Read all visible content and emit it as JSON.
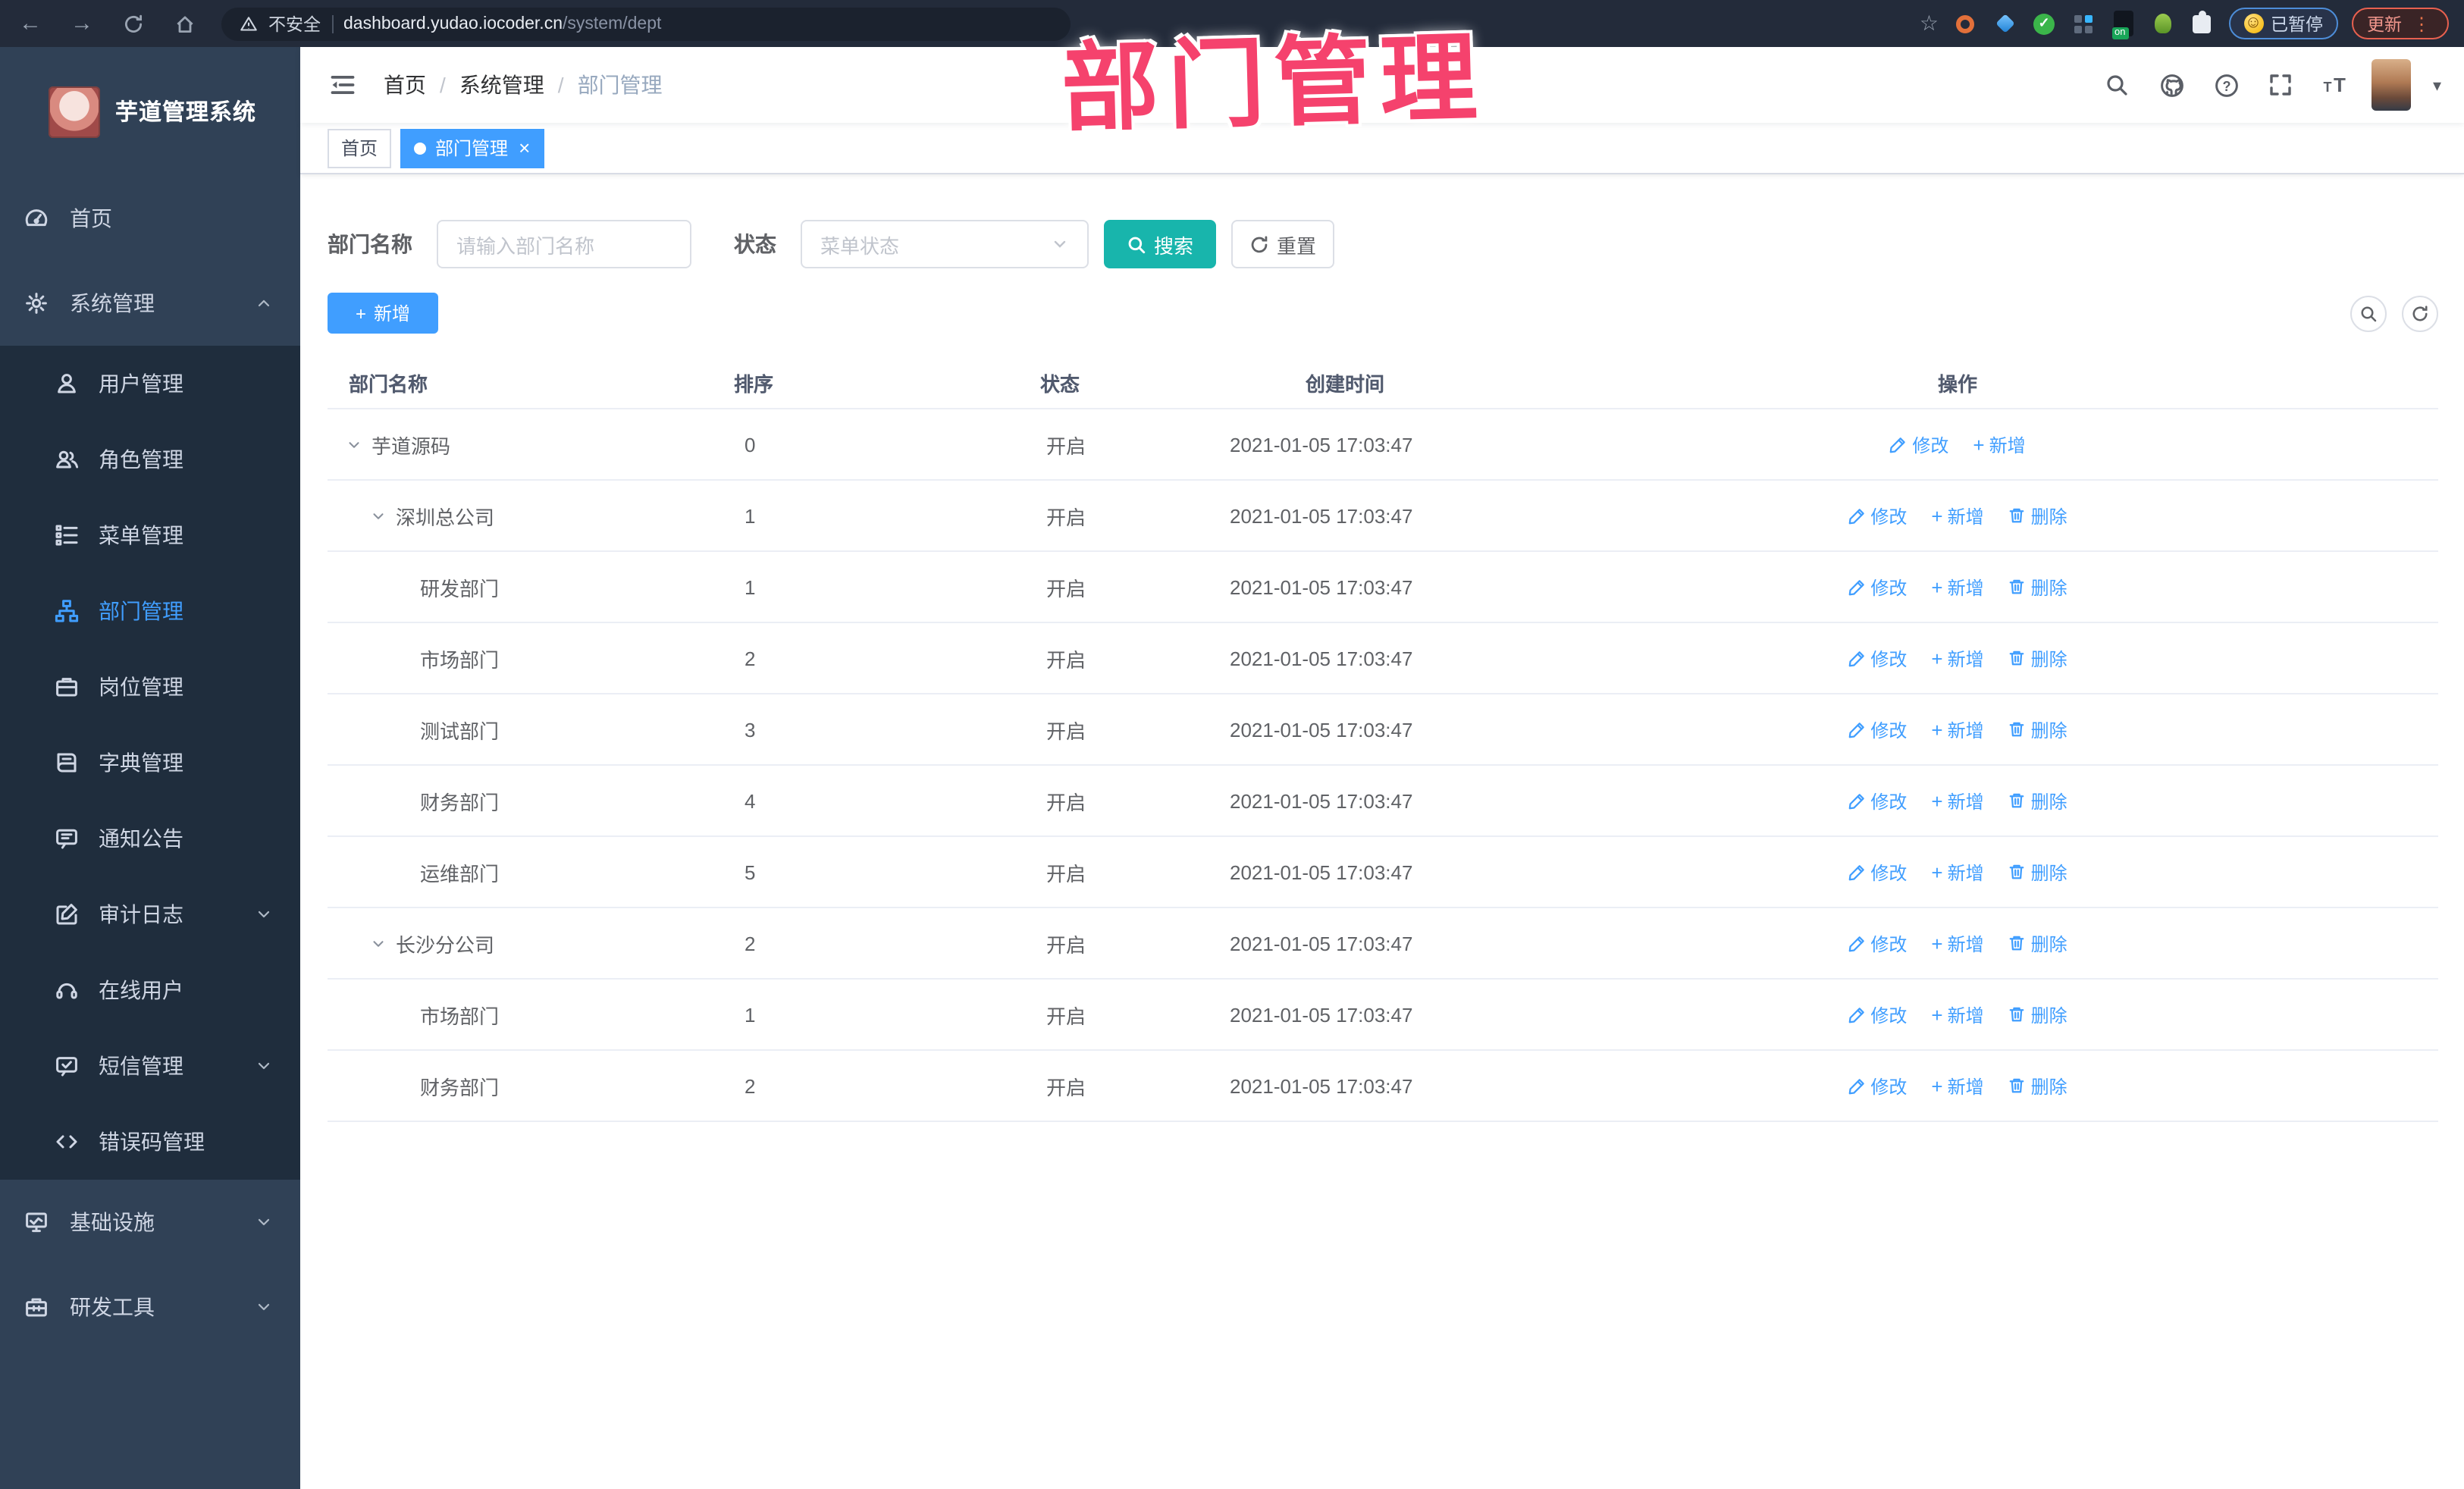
{
  "browser": {
    "security_label": "不安全",
    "url_host": "dashboard.yudao.iocoder.cn",
    "url_path": "/system/dept",
    "paused_label": "已暂停",
    "update_label": "更新",
    "extension_badge": "on"
  },
  "watermark": "部门管理",
  "sidebar": {
    "title": "芋道管理系统",
    "menu": [
      {
        "label": "首页",
        "icon": "dashboard-icon",
        "type": "top"
      },
      {
        "label": "系统管理",
        "icon": "gear-icon",
        "type": "top",
        "chevron": "up"
      },
      {
        "label": "用户管理",
        "icon": "user-icon",
        "type": "sub"
      },
      {
        "label": "角色管理",
        "icon": "users-icon",
        "type": "sub"
      },
      {
        "label": "菜单管理",
        "icon": "menu-tree-icon",
        "type": "sub"
      },
      {
        "label": "部门管理",
        "icon": "org-tree-icon",
        "type": "sub",
        "active": true
      },
      {
        "label": "岗位管理",
        "icon": "briefcase-icon",
        "type": "sub"
      },
      {
        "label": "字典管理",
        "icon": "book-icon",
        "type": "sub"
      },
      {
        "label": "通知公告",
        "icon": "megaphone-icon",
        "type": "sub"
      },
      {
        "label": "审计日志",
        "icon": "audit-icon",
        "type": "sub",
        "chevron": "down"
      },
      {
        "label": "在线用户",
        "icon": "headset-icon",
        "type": "sub"
      },
      {
        "label": "短信管理",
        "icon": "sms-icon",
        "type": "sub",
        "chevron": "down"
      },
      {
        "label": "错误码管理",
        "icon": "code-icon",
        "type": "sub"
      },
      {
        "label": "基础设施",
        "icon": "monitor-icon",
        "type": "top",
        "chevron": "down"
      },
      {
        "label": "研发工具",
        "icon": "toolbox-icon",
        "type": "top",
        "chevron": "down"
      }
    ]
  },
  "header": {
    "breadcrumb": [
      "首页",
      "系统管理",
      "部门管理"
    ],
    "separator": "/"
  },
  "tabs": [
    {
      "label": "首页",
      "active": false
    },
    {
      "label": "部门管理",
      "active": true,
      "close": "×"
    }
  ],
  "filters": {
    "name_label": "部门名称",
    "name_placeholder": "请输入部门名称",
    "status_label": "状态",
    "status_placeholder": "菜单状态",
    "search_label": "搜索",
    "reset_label": "重置"
  },
  "toolbar": {
    "add_label": "新增"
  },
  "table": {
    "columns": [
      "部门名称",
      "排序",
      "状态",
      "创建时间",
      "操作"
    ],
    "action_labels": {
      "edit": "修改",
      "add": "新增",
      "delete": "删除"
    },
    "rows": [
      {
        "name": "芋道源码",
        "level": 0,
        "expandable": true,
        "sort": "0",
        "status": "开启",
        "time": "2021-01-05 17:03:47",
        "actions": [
          "edit",
          "add"
        ]
      },
      {
        "name": "深圳总公司",
        "level": 1,
        "expandable": true,
        "sort": "1",
        "status": "开启",
        "time": "2021-01-05 17:03:47",
        "actions": [
          "edit",
          "add",
          "delete"
        ]
      },
      {
        "name": "研发部门",
        "level": 2,
        "expandable": false,
        "sort": "1",
        "status": "开启",
        "time": "2021-01-05 17:03:47",
        "actions": [
          "edit",
          "add",
          "delete"
        ]
      },
      {
        "name": "市场部门",
        "level": 2,
        "expandable": false,
        "sort": "2",
        "status": "开启",
        "time": "2021-01-05 17:03:47",
        "actions": [
          "edit",
          "add",
          "delete"
        ]
      },
      {
        "name": "测试部门",
        "level": 2,
        "expandable": false,
        "sort": "3",
        "status": "开启",
        "time": "2021-01-05 17:03:47",
        "actions": [
          "edit",
          "add",
          "delete"
        ]
      },
      {
        "name": "财务部门",
        "level": 2,
        "expandable": false,
        "sort": "4",
        "status": "开启",
        "time": "2021-01-05 17:03:47",
        "actions": [
          "edit",
          "add",
          "delete"
        ]
      },
      {
        "name": "运维部门",
        "level": 2,
        "expandable": false,
        "sort": "5",
        "status": "开启",
        "time": "2021-01-05 17:03:47",
        "actions": [
          "edit",
          "add",
          "delete"
        ]
      },
      {
        "name": "长沙分公司",
        "level": 1,
        "expandable": true,
        "sort": "2",
        "status": "开启",
        "time": "2021-01-05 17:03:47",
        "actions": [
          "edit",
          "add",
          "delete"
        ]
      },
      {
        "name": "市场部门",
        "level": 2,
        "expandable": false,
        "sort": "1",
        "status": "开启",
        "time": "2021-01-05 17:03:47",
        "actions": [
          "edit",
          "add",
          "delete"
        ]
      },
      {
        "name": "财务部门",
        "level": 2,
        "expandable": false,
        "sort": "2",
        "status": "开启",
        "time": "2021-01-05 17:03:47",
        "actions": [
          "edit",
          "add",
          "delete"
        ]
      }
    ]
  },
  "colors": {
    "accent": "#409eff",
    "search_button": "#18b5ac",
    "watermark": "#f5426d",
    "sidebar": "#304156",
    "submenu": "#1f2d3d"
  }
}
